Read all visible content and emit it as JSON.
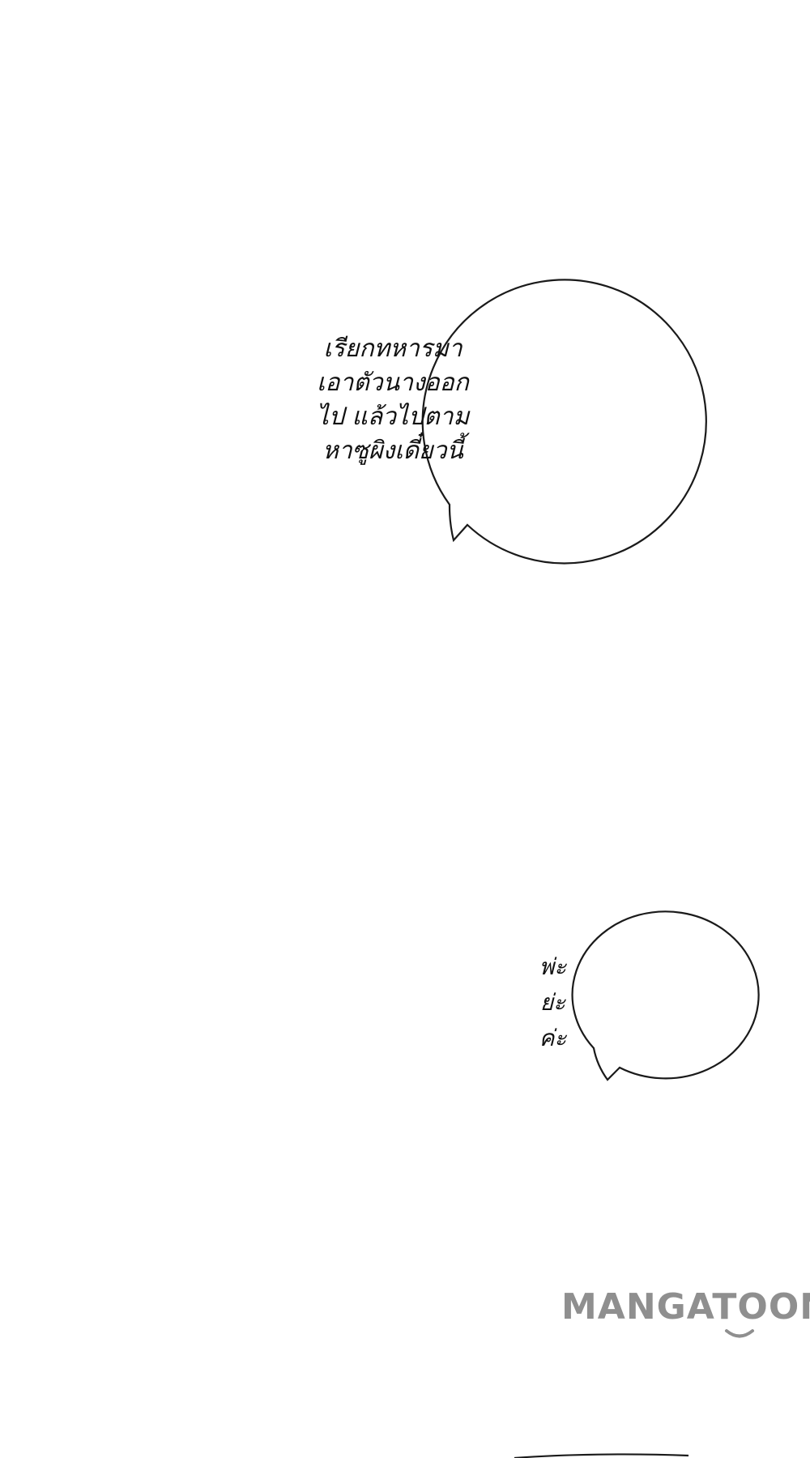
{
  "bubbles": [
    {
      "lines": [
        "เรียกทหารมา",
        "เอาตัวนางออก",
        "ไป แล้วไปตาม",
        "หาซูผิงเดี๋ยวนี้"
      ]
    },
    {
      "lines": [
        "พ่ะ",
        "ย่ะ",
        "ค่ะ"
      ]
    }
  ],
  "watermark": {
    "text": "MANGATOON"
  },
  "colors": {
    "background": "#ffffff",
    "outline": "#1a1a1a",
    "watermark": "#8f8f8f"
  }
}
